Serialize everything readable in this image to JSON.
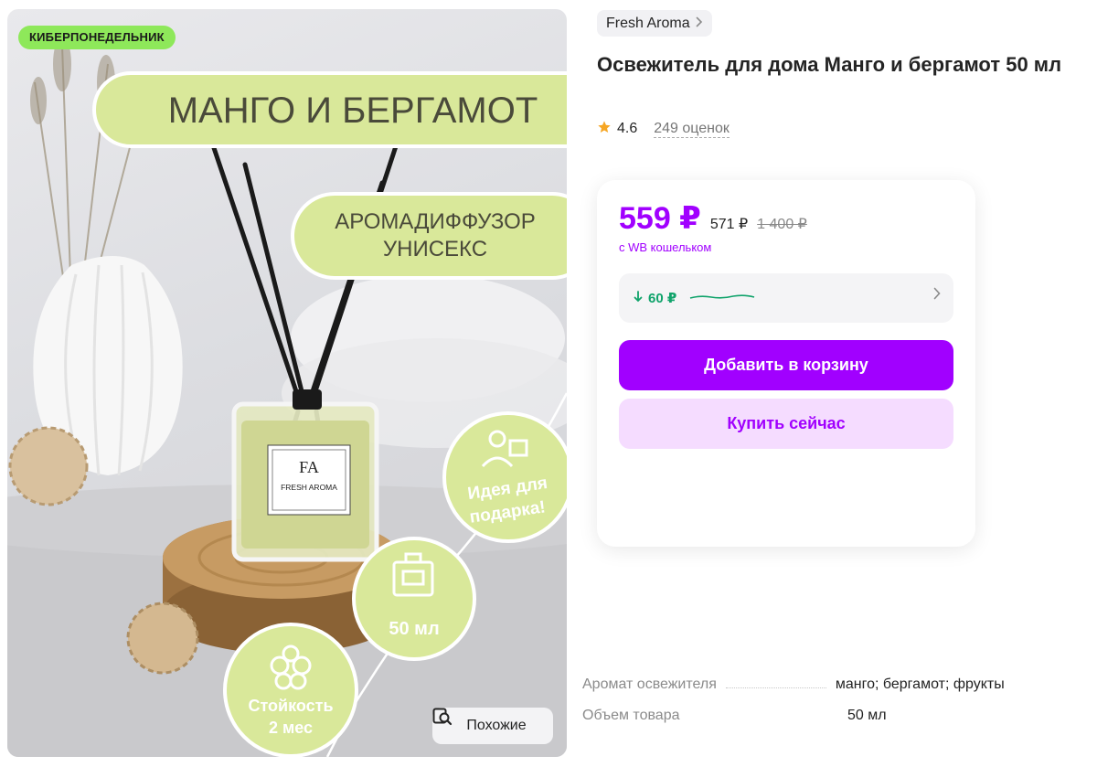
{
  "gallery": {
    "promo_badge": "КИБЕРПОНЕДЕЛЬНИК",
    "headline": "МАНГО И БЕРГАМОТ",
    "type_line1": "АРОМАДИФФУЗОР",
    "type_line2": "УНИСЕКС",
    "gift_line1": "Идея для",
    "gift_line2": "подарка!",
    "volume": "50 мл",
    "durability_line1": "Стойкость",
    "durability_line2": "2 мес",
    "bottle_logo": "FA",
    "bottle_brand": "FRESH AROMA",
    "similar_label": "Похожие"
  },
  "brand": {
    "name": "Fresh Aroma"
  },
  "product": {
    "title": "Освежитель для дома Манго и бергамот 50 мл"
  },
  "rating": {
    "value": "4.6",
    "reviews": "249 оценок"
  },
  "price": {
    "current": "559 ₽",
    "old": "571 ₽",
    "original": "1 400 ₽",
    "wallet_note": "с WB кошельком",
    "drop": "60 ₽"
  },
  "actions": {
    "add_to_cart": "Добавить в корзину",
    "buy_now": "Купить сейчас"
  },
  "specs": [
    {
      "name": "Аромат освежителя",
      "value": "манго; бергамот; фрукты"
    },
    {
      "name": "Объем товара",
      "value": "50 мл"
    }
  ],
  "colors": {
    "accent": "#a100ff",
    "accent_light": "#f5dcff",
    "badge": "#8ee85a",
    "drop": "#10a36b",
    "label_green": "#d9e89a"
  }
}
